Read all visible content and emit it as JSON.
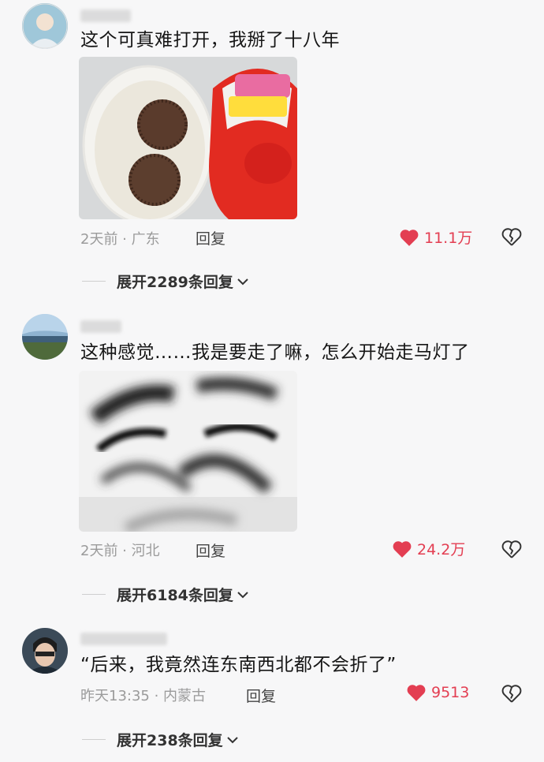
{
  "comments": [
    {
      "text": "这个可真难打开，我掰了十八年",
      "meta": "2天前 · 广东",
      "reply_label": "回复",
      "likes": "11.1万",
      "expand_label": "展开2289条回复"
    },
    {
      "text": "这种感觉……我是要走了嘛，怎么开始走马灯了",
      "meta": "2天前 · 河北",
      "reply_label": "回复",
      "likes": "24.2万",
      "expand_label": "展开6184条回复"
    },
    {
      "text": "“后来，我竟然连东南西北都不会折了”",
      "meta": "昨天13:35 · 内蒙古",
      "reply_label": "回复",
      "likes": "9513",
      "expand_label": "展开238条回复"
    }
  ],
  "colors": {
    "like": "#e33e52",
    "meta": "#9b9b9b",
    "background": "#f7f7f8"
  },
  "icons": {
    "like": "heart-icon",
    "dislike": "broken-heart-icon",
    "expand": "chevron-down-icon"
  }
}
